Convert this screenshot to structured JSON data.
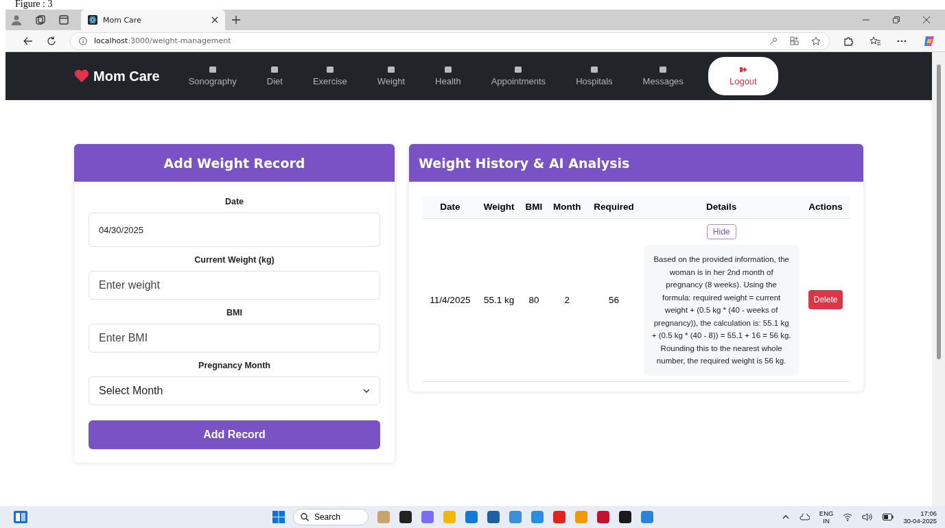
{
  "caption": "Figure : 3",
  "browser": {
    "tab": {
      "title": "Mom Care"
    },
    "address": {
      "host": "localhost",
      "path": ":3000/weight-management"
    }
  },
  "navbar": {
    "brand": "Mom Care",
    "items": [
      {
        "label": "Sonography"
      },
      {
        "label": "Diet"
      },
      {
        "label": "Exercise"
      },
      {
        "label": "Weight"
      },
      {
        "label": "Health"
      },
      {
        "label": "Appointments"
      },
      {
        "label": "Hospitals"
      },
      {
        "label": "Messages"
      }
    ],
    "logout": "Logout"
  },
  "add_form": {
    "title": "Add Weight Record",
    "fields": [
      {
        "kind": "input",
        "label": "Date",
        "value": "04/30/2025"
      },
      {
        "kind": "input",
        "label": "Current Weight (kg)",
        "placeholder": "Enter weight"
      },
      {
        "kind": "input",
        "label": "BMI",
        "placeholder": "Enter BMI"
      },
      {
        "kind": "select",
        "label": "Pregnancy Month",
        "value": "Select Month"
      }
    ],
    "submit": "Add Record"
  },
  "history": {
    "title": "Weight History & AI Analysis",
    "columns": [
      "Date",
      "Weight",
      "BMI",
      "Month",
      "Required",
      "Details",
      "Actions"
    ],
    "rows": [
      {
        "date": "11/4/2025",
        "weight": "55.1 kg",
        "bmi": "80",
        "month": "2",
        "required": "56",
        "details_toggle": "Hide",
        "expanded": true,
        "details": "Based on the provided information, the woman is in her 2nd month of pregnancy (8 weeks). Using the formula: required weight = current weight + (0.5 kg * (40 - weeks of pregnancy)), the calculation is: 55.1 kg + (0.5 kg * (40 - 8)) = 55.1 + 16 = 56 kg. Rounding this to the nearest whole number, the required weight is 56 kg.",
        "action": "Delete"
      }
    ]
  },
  "taskbar": {
    "search": "Search",
    "language": "ENG",
    "region": "IN",
    "time": "17:06",
    "date": "30-04-2025"
  }
}
